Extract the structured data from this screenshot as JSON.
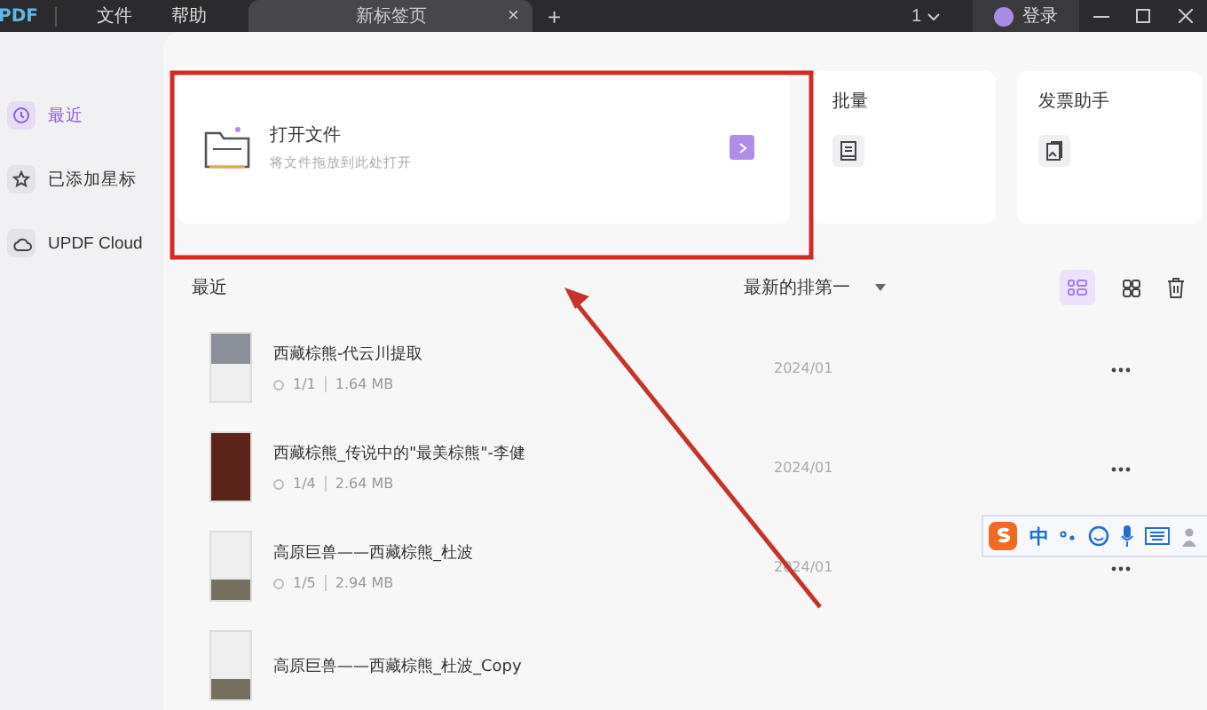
{
  "titlebar": {
    "logo": "PDF",
    "menus": [
      "文件",
      "帮助"
    ],
    "tab": {
      "label": "新标签页",
      "close": "×"
    },
    "new_tab": "+",
    "page_count": "1",
    "login": "登录"
  },
  "sidebar": {
    "items": [
      {
        "kind": "clock",
        "label": "最近",
        "selected": true
      },
      {
        "kind": "star",
        "label": "已添加星标",
        "selected": false
      },
      {
        "kind": "cloud",
        "label": "UPDF Cloud",
        "selected": false
      }
    ]
  },
  "tools": [
    {
      "kind": "open",
      "title": "打开文件",
      "subtitle": "将文件拖放到此处打开"
    },
    {
      "kind": "batch",
      "title": "批量"
    },
    {
      "kind": "invoice",
      "title": "发票助手"
    }
  ],
  "recent": {
    "title": "最近",
    "sort": "最新的排第一",
    "views": [
      {
        "kind": "list",
        "selected": true
      },
      {
        "kind": "grid",
        "selected": false
      }
    ],
    "files": [
      {
        "title": "西藏棕熊-代云川提取",
        "pages": "1/1",
        "size": "1.64 MB",
        "date": "2024/01",
        "kind": "photo"
      },
      {
        "title": "西藏棕熊_传说中的\"最美棕熊\"-李健",
        "pages": "1/4",
        "size": "2.64 MB",
        "date": "2024/01",
        "kind": "dark"
      },
      {
        "title": "高原巨兽——西藏棕熊_杜波",
        "pages": "1/5",
        "size": "2.94 MB",
        "date": "2024/01",
        "kind": "doc"
      },
      {
        "title": "高原巨兽——西藏棕熊_杜波_Copy",
        "kind": "doc"
      }
    ]
  },
  "ime_toolbar": {
    "mode": "中"
  }
}
